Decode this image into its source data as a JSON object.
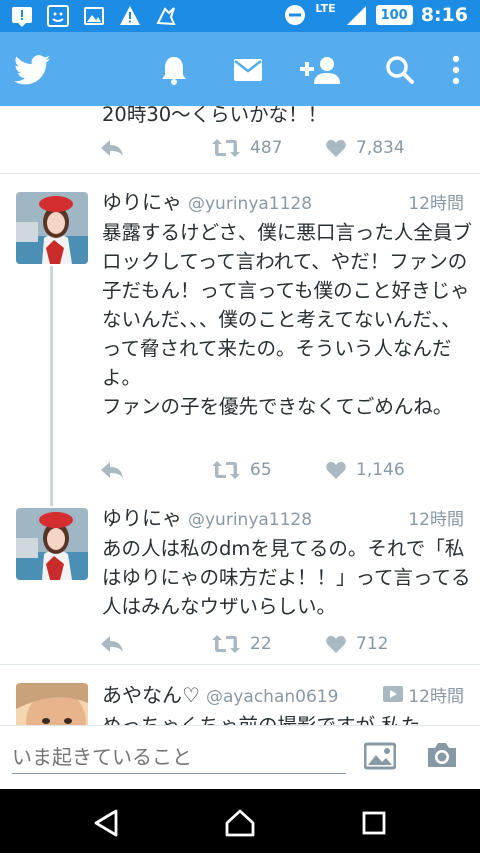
{
  "status_bar": {
    "network": "LTE",
    "battery": "100",
    "time": "8:16"
  },
  "tweets": [
    {
      "text": "20時30〜くらいかな！！",
      "retweets": "487",
      "likes": "7,834"
    },
    {
      "name": "ゆりにゃ",
      "handle": "@yurinya1128",
      "time": "12時間",
      "text": "暴露するけどさ、僕に悪口言った人全員ブロックしてって言われて、やだ！ファンの子だもん！って言っても僕のこと好きじゃないんだ、、、僕のこと考えてないんだ、、って脅されて来たの。そういう人なんだよ。\nファンの子を優先できなくてごめんね。",
      "retweets": "65",
      "likes": "1,146"
    },
    {
      "name": "ゆりにゃ",
      "handle": "@yurinya1128",
      "time": "12時間",
      "text": "あの人は私のdmを見てるの。それで「私はゆりにゃの味方だよ！！」って言ってる人はみんなウザいらしい。",
      "retweets": "22",
      "likes": "712"
    },
    {
      "name": "あやなん♡",
      "handle": "@ayachan0619",
      "time": "12時間",
      "text": "めっちゃくちゃ前の撮影ですが 私た"
    }
  ],
  "compose": {
    "placeholder": "いま起きていること"
  },
  "colors": {
    "appbar": "#55acee",
    "statusbar": "#1c8ce4",
    "secondary_text": "#8899a6"
  }
}
